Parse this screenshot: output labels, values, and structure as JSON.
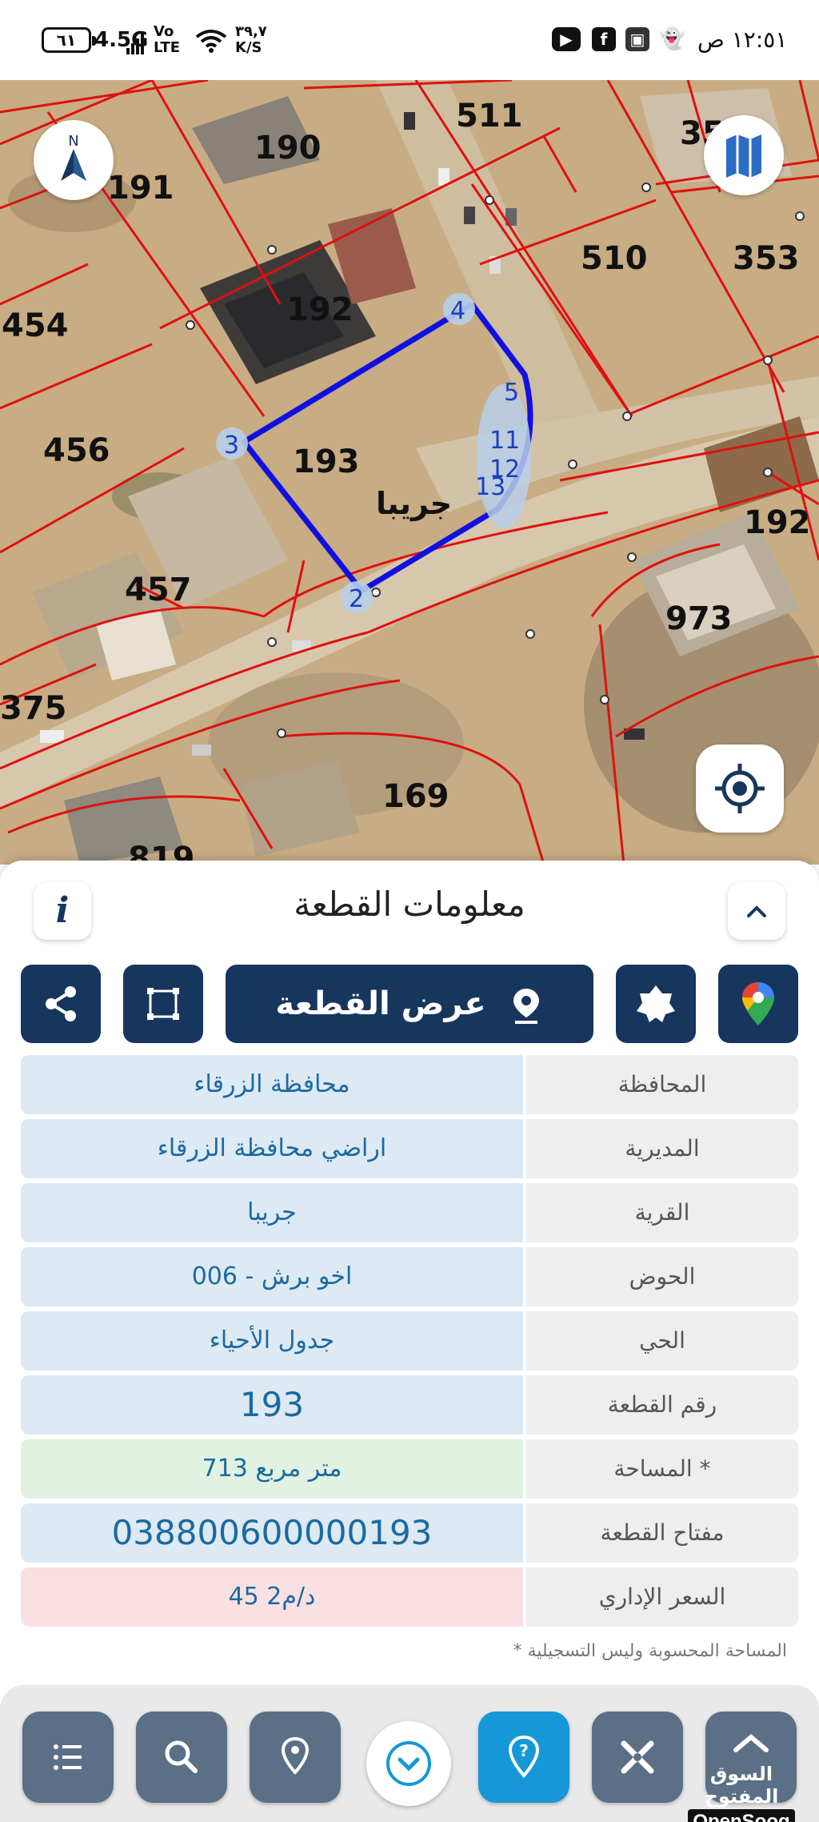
{
  "status_bar": {
    "time": "١٢:٥١ ص",
    "battery": "٦١",
    "network": "4.5G",
    "volte_top": "Vo",
    "volte_bottom": "LTE",
    "speed_value": "٣٩,٧",
    "speed_unit": "K/S",
    "notification_icons": [
      "dot-icon",
      "youtube-icon",
      "facebook-icon",
      "opensooq-icon",
      "snapchat-icon"
    ]
  },
  "map": {
    "compass_label": "N",
    "plot_labels": [
      "511",
      "190",
      "191",
      "35",
      "510",
      "353",
      "454",
      "192",
      "193",
      "456",
      "457",
      "192",
      "973",
      "375",
      "169",
      "819"
    ],
    "village_label": "جريبا",
    "vertex_labels": [
      "4",
      "3",
      "2",
      "5",
      "11",
      "12",
      "13"
    ]
  },
  "sheet": {
    "title": "معلومات القطعة",
    "info_icon": "i",
    "view_plot_button": "عرض القطعة",
    "rows": [
      {
        "label": "المحافظة",
        "value": "محافظة الزرقاء"
      },
      {
        "label": "المديرية",
        "value": "اراضي محافظة الزرقاء"
      },
      {
        "label": "القرية",
        "value": "جريبا"
      },
      {
        "label": "الحوض",
        "value": "اخو برش - 006"
      },
      {
        "label": "الحي",
        "value": "جدول الأحياء"
      },
      {
        "label": "رقم القطعة",
        "value": "193"
      },
      {
        "label": "المساحة *",
        "value": "713  متر مربع"
      },
      {
        "label": "مفتاح القطعة",
        "value": "038800600000193"
      },
      {
        "label": "السعر الإداري",
        "value": "45 د/م2"
      }
    ],
    "footnote": "* المساحة المحسوبة وليس التسجيلية"
  },
  "watermark": {
    "arabic": "السوق المفتوح",
    "english": "OpenSooq"
  },
  "colors": {
    "primary_navy": "#17365d",
    "active_blue": "#1597d8",
    "plot_outline": "#1010e0",
    "parcel_lines": "#e01010"
  }
}
